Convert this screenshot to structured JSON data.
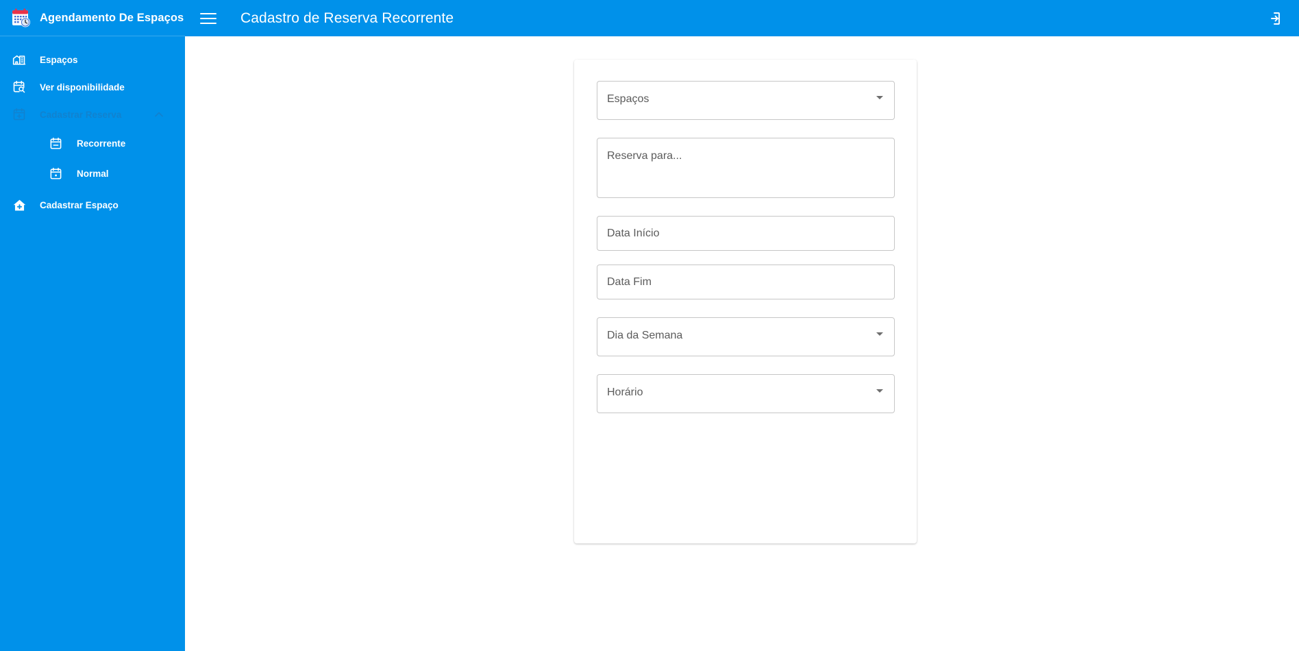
{
  "brand": {
    "title": "Agendamento De Espaços",
    "logo_icon": "calendar-clock-icon"
  },
  "sidebar": {
    "items": [
      {
        "label": "Espaços",
        "icon": "building-home-icon",
        "level": "top",
        "state": "normal"
      },
      {
        "label": "Ver disponibilidade",
        "icon": "calendar-search-icon",
        "level": "top",
        "state": "normal"
      },
      {
        "label": "Cadastrar Reserva",
        "icon": "calendar-plus-icon",
        "level": "top",
        "state": "expanded",
        "chevron": "chevron-up-icon"
      },
      {
        "label": "Recorrente",
        "icon": "calendar-recurrent-icon",
        "level": "child",
        "state": "normal"
      },
      {
        "label": "Normal",
        "icon": "calendar-normal-icon",
        "level": "child",
        "state": "normal"
      },
      {
        "label": "Cadastrar Espaço",
        "icon": "home-plus-icon",
        "level": "top",
        "state": "normal"
      }
    ]
  },
  "topbar": {
    "menu_icon": "hamburger-menu-icon",
    "title": "Cadastro de Reserva Recorrente",
    "logout_icon": "logout-icon"
  },
  "form": {
    "fields": [
      {
        "name": "espacos",
        "type": "select",
        "placeholder": "Espaços",
        "value": "",
        "arrow_icon": "dropdown-arrow-icon"
      },
      {
        "name": "reserva_para",
        "type": "textarea",
        "placeholder": "Reserva para...",
        "value": ""
      },
      {
        "name": "data_inicio",
        "type": "input",
        "placeholder": "Data Início",
        "value": ""
      },
      {
        "name": "data_fim",
        "type": "input",
        "placeholder": "Data Fim",
        "value": ""
      },
      {
        "name": "dia_da_semana",
        "type": "select",
        "placeholder": "Dia da Semana",
        "value": "",
        "arrow_icon": "dropdown-arrow-icon"
      },
      {
        "name": "horario",
        "type": "select",
        "placeholder": "Horário",
        "value": "",
        "arrow_icon": "dropdown-arrow-icon"
      }
    ]
  },
  "colors": {
    "primary_blue": "#0091ea",
    "sidebar_blue": "#0091ea",
    "dimmed_blue": "#1182cf",
    "field_border": "#c6c6c6",
    "placeholder_text": "#5b5b5b",
    "logo_red": "#e8334a"
  }
}
